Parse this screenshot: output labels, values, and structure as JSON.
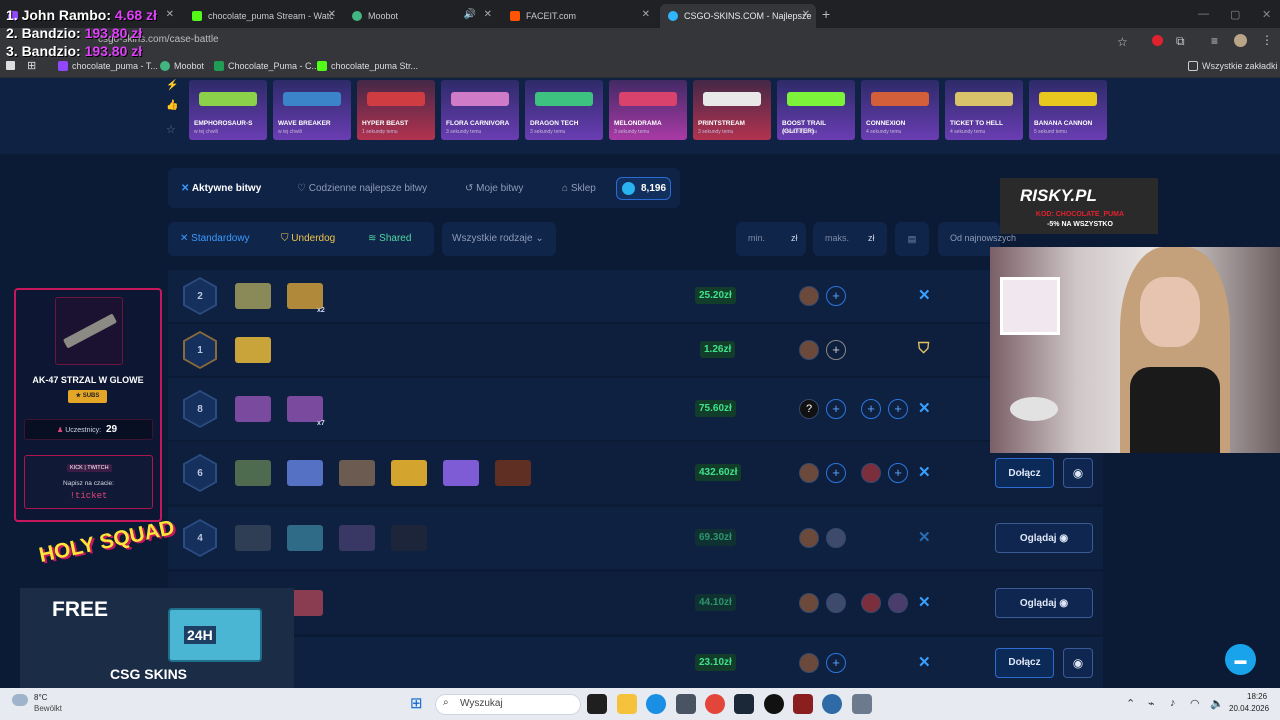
{
  "browser": {
    "tabs": [
      {
        "label": "",
        "active": false
      },
      {
        "label": "chocolate_puma Stream - Watc",
        "active": false
      },
      {
        "label": "Moobot",
        "active": false
      },
      {
        "label": "FACEIT.com",
        "active": false
      },
      {
        "label": "CSGO-SKINS.COM - Najlepsze",
        "active": true
      }
    ],
    "url": "csgo-skins.com/case-battle",
    "bookmarks": [
      "chocolate_puma - T...",
      "Moobot",
      "Chocolate_Puma - C...",
      "chocolate_puma Str..."
    ],
    "bookmarks_right": "Wszystkie zakładki"
  },
  "ranking": [
    {
      "rank": "1. John Rambo:",
      "amount": "4.68 zł"
    },
    {
      "rank": "2. Bandzio:",
      "amount": "193.80 zł"
    },
    {
      "rank": "3. Bandzio:",
      "amount": "193.80 zł"
    }
  ],
  "skins": [
    {
      "name": "EMPHOROSAUR-S",
      "time": "w tej chwili",
      "color": "#6a3db3"
    },
    {
      "name": "WAVE BREAKER",
      "time": "w tej chwili",
      "color": "#6a3db3"
    },
    {
      "name": "HYPER BEAST",
      "time": "1 sekundę temu",
      "color": "#b2334f"
    },
    {
      "name": "FLORA CARNIVORA",
      "time": "3 sekundy temu",
      "color": "#6a3db3"
    },
    {
      "name": "DRAGON TECH",
      "time": "3 sekundy temu",
      "color": "#6a3db3"
    },
    {
      "name": "MELONDRAMA",
      "time": "3 sekundy temu",
      "color": "#a93aa6"
    },
    {
      "name": "PRINTSTREAM",
      "time": "3 sekundy temu",
      "color": "#b2334f"
    },
    {
      "name": "BOOST TRAIL (GLITTER)",
      "time": "4 sekundy temu",
      "color": "#6a3db3"
    },
    {
      "name": "CONNEXION",
      "time": "4 sekundy temu",
      "color": "#6a3db3"
    },
    {
      "name": "TICKET TO HELL",
      "time": "4 sekundy temu",
      "color": "#6a3db3"
    },
    {
      "name": "BANANA CANNON",
      "time": "5 sekund temu",
      "color": "#6a3db3"
    }
  ],
  "nav": {
    "active": "Aktywne bitwy",
    "daily": "Codzienne najlepsze bitwy",
    "mine": "Moje bitwy",
    "shop": "Sklep",
    "coins": "8,196"
  },
  "filters": {
    "standard": "Standardowy",
    "underdog": "Underdog",
    "shared": "Shared",
    "all": "Wszystkie rodzaje",
    "min": "min.",
    "max": "maks.",
    "currency": "zł",
    "sort": "Od najnowszych"
  },
  "rows": [
    {
      "rounds": "2",
      "mult": "x2",
      "price": "25.20zł",
      "players": "1/2",
      "button": ""
    },
    {
      "rounds": "1",
      "mult": "",
      "price": "1.26zł",
      "players": "1/2",
      "button": ""
    },
    {
      "rounds": "8",
      "mult": "x7",
      "price": "75.60zł",
      "players": "1/4",
      "button": ""
    },
    {
      "rounds": "6",
      "mult": "",
      "price": "432.60zł",
      "players": "2/4",
      "button": "Dołącz"
    },
    {
      "rounds": "4",
      "mult": "",
      "price": "69.30zł",
      "players": "2/2",
      "button": "Oglądaj"
    },
    {
      "rounds": "",
      "mult": "",
      "price": "44.10zł",
      "players": "4/4",
      "button": "Oglądaj"
    },
    {
      "rounds": "",
      "mult": "",
      "price": "23.10zł",
      "players": "1/2",
      "button": "Dołącz"
    }
  ],
  "overlay": {
    "king_title": "AK-47 STRZAL W GLOWE",
    "subs": "SUBS",
    "participants_label": "Uczestnicy:",
    "participants": "29",
    "ticket_platforms": "KICK | TWITCH",
    "ticket_hint": "Napisz na czacie:",
    "ticket": "!ticket",
    "holy": "HOLY SQUAD",
    "free": "FREE",
    "brand": "CSG SKINS",
    "box": "24H",
    "risky": "RISKY.PL",
    "risky_code": "KOD: CHOCOLATE_PUMA",
    "risky_disc": "-5% NA WSZYSTKO"
  },
  "taskbar": {
    "weather_temp": "8°C",
    "weather": "Bewölkt",
    "search": "Wyszukaj",
    "time": "18:26",
    "date": "20.04.2026"
  }
}
